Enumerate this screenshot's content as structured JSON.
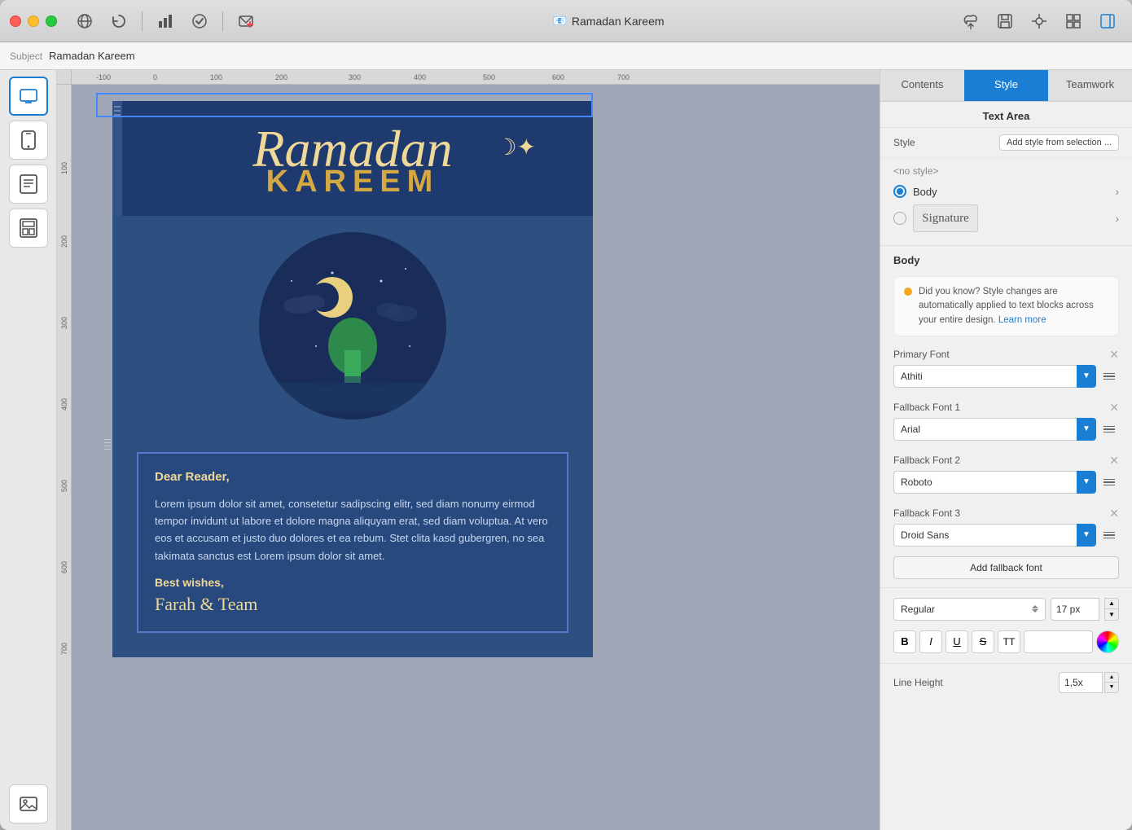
{
  "window": {
    "title": "Ramadan Kareem",
    "title_icon": "📧"
  },
  "titlebar": {
    "traffic_lights": [
      "red",
      "yellow",
      "green"
    ],
    "toolbar_left": [
      {
        "name": "globe-icon",
        "icon": "🌐"
      },
      {
        "name": "refresh-icon",
        "icon": "↻"
      },
      {
        "name": "check-icon",
        "icon": "✓"
      },
      {
        "name": "x-icon",
        "icon": "✕"
      }
    ],
    "toolbar_right": [
      {
        "name": "cloud-icon",
        "icon": "☁"
      },
      {
        "name": "save-icon",
        "icon": "💾"
      },
      {
        "name": "crosshair-icon",
        "icon": "⊕"
      },
      {
        "name": "layout-icon",
        "icon": "▦"
      },
      {
        "name": "sidebar-icon",
        "icon": "▣"
      }
    ]
  },
  "subjectbar": {
    "label": "Subject",
    "value": "Ramadan Kareem"
  },
  "left_sidebar": {
    "buttons": [
      {
        "name": "desktop-view",
        "icon": "🖥"
      },
      {
        "name": "mobile-view",
        "icon": "📱"
      },
      {
        "name": "text-view",
        "icon": "📄"
      },
      {
        "name": "template-view",
        "icon": "📋"
      }
    ]
  },
  "email_design": {
    "ramadan_title": "Ramadan",
    "kareem_title": "KAREEM",
    "dear_reader": "Dear Reader,",
    "body_text": "Lorem ipsum dolor sit amet, consetetur sadipscing elitr, sed diam nonumy eirmod tempor invidunt ut labore et dolore magna aliquyam erat, sed diam voluptua. At vero eos et accusam et justo duo dolores et ea rebum. Stet clita kasd gubergren, no sea takimata sanctus est Lorem ipsum dolor sit amet.",
    "best_wishes": "Best wishes,",
    "signature": "Farah & Team"
  },
  "right_panel": {
    "tabs": [
      {
        "name": "contents",
        "label": "Contents"
      },
      {
        "name": "style",
        "label": "Style",
        "active": true
      },
      {
        "name": "teamwork",
        "label": "Teamwork"
      }
    ],
    "section_title": "Text Area",
    "style_label": "Style",
    "add_style_btn": "Add style from selection ...",
    "no_style": "<no style>",
    "styles": [
      {
        "name": "Body",
        "active": true
      },
      {
        "name": "Signature",
        "preview": true
      }
    ],
    "body_section": {
      "title": "Body",
      "info_text": "Did you know? Style changes are automatically applied to text blocks across your entire design.",
      "info_link": "Learn more",
      "primary_font_label": "Primary Font",
      "primary_font_value": "Athiti",
      "fallback1_label": "Fallback Font 1",
      "fallback1_value": "Arial",
      "fallback2_label": "Fallback Font 2",
      "fallback2_value": "Roboto",
      "fallback3_label": "Fallback Font 3",
      "fallback3_value": "Droid Sans",
      "add_fallback_btn": "Add fallback font",
      "text_style_value": "Regular",
      "font_size_value": "17 px",
      "format_buttons": [
        "B",
        "I",
        "U",
        "S̶",
        "TT"
      ],
      "line_height_label": "Line Height",
      "line_height_value": "1,5x"
    }
  },
  "ruler": {
    "marks": [
      "-100",
      "0",
      "100",
      "200",
      "300",
      "400",
      "500",
      "600",
      "700"
    ]
  }
}
